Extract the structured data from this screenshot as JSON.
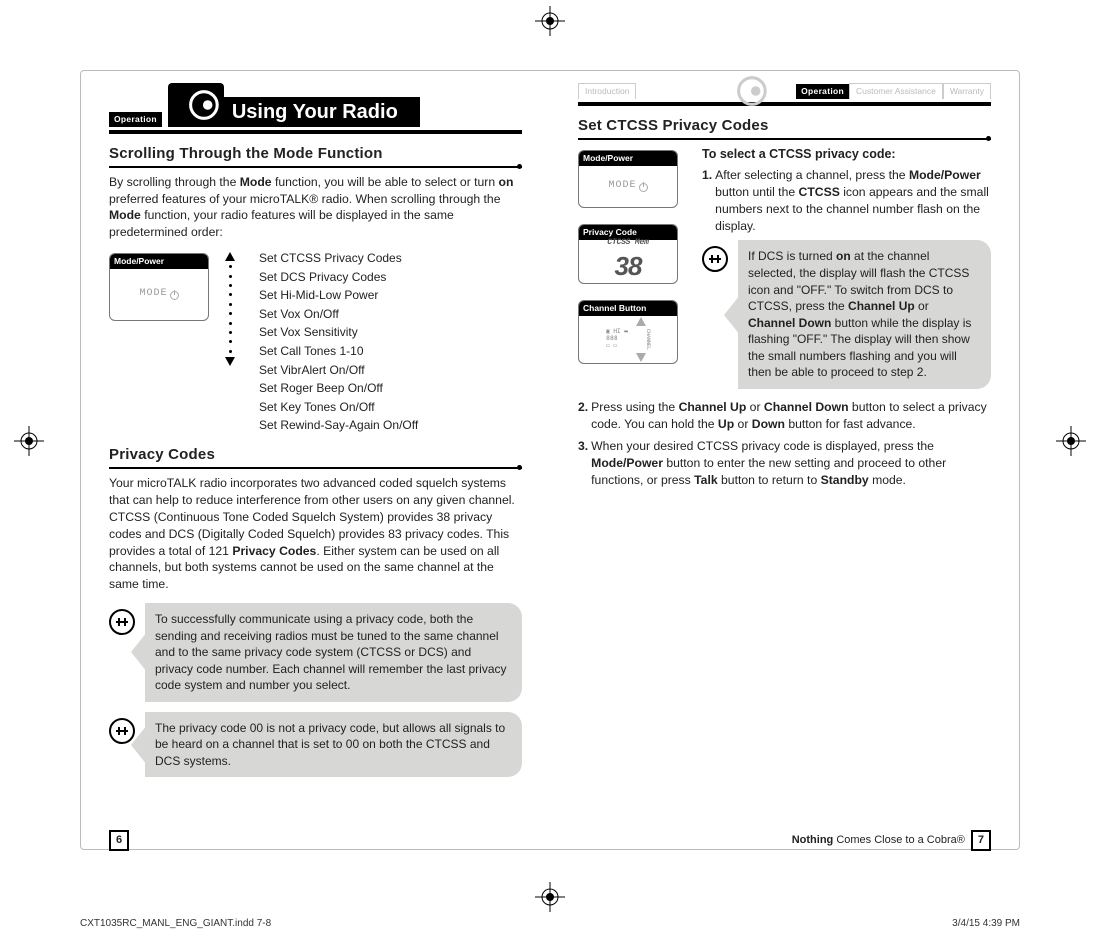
{
  "header": {
    "title": "Using Your Radio",
    "op_badge": "Operation"
  },
  "tabs": {
    "intro": "Introduction",
    "operation": "Operation",
    "cust": "Customer Assistance",
    "warranty": "Warranty"
  },
  "left": {
    "sec1_title": "Scrolling Through the Mode Function",
    "sec1_body": "By scrolling through the <b>Mode</b> function, you will be able to select or turn <b>on</b> preferred features of your microTALK® radio. When scrolling through the <b>Mode</b> function, your radio features will be displayed in the same predetermined order:",
    "icon_mode_label": "Mode/Power",
    "icon_mode_text": "MODE",
    "mode_items": [
      "Set CTCSS Privacy Codes",
      "Set DCS Privacy Codes",
      "Set Hi-Mid-Low Power",
      "Set Vox On/Off",
      "Set Vox Sensitivity",
      "Set Call Tones 1-10",
      "Set VibrAlert On/Off",
      "Set Roger Beep On/Off",
      "Set Key Tones On/Off",
      "Set Rewind-Say-Again On/Off"
    ],
    "sec2_title": "Privacy Codes",
    "sec2_body": "Your microTALK radio incorporates two advanced coded squelch systems that can help to reduce interference from other users on any given channel. CTCSS (Continuous Tone Coded Squelch System) provides 38 privacy codes and DCS (Digitally Coded Squelch) provides 83 privacy codes. This provides a total of 121 <b>Privacy Codes</b>. Either system can be used on all channels, but both systems cannot be used on the same channel at the same time.",
    "note1": "To successfully communicate using a privacy code, both the sending and receiving radios must be tuned to the same channel and to the same privacy code system (CTCSS or DCS) and privacy code number. Each channel will remember the last privacy code system and number you select.",
    "note2": "The privacy code 00 is not a privacy code, but allows all signals to be heard on a channel that is set to 00 on both the CTCSS and DCS systems."
  },
  "right": {
    "sec_title": "Set CTCSS Privacy Codes",
    "lead": "To select a CTCSS privacy code:",
    "icon1_label": "Mode/Power",
    "icon1_text": "MODE",
    "icon2_label": "Privacy Code",
    "icon2_top": "CTCSS Mem",
    "icon2_num": "38",
    "icon3_label": "Channel Button",
    "step1": "After selecting a channel, press the <b>Mode/Power</b> button until the <b>CTCSS</b> icon appears and the small numbers next to the channel number flash on the display.",
    "note": "If DCS is turned <b>on</b> at the channel selected, the display will flash the CTCSS icon and \"OFF.\" To switch from DCS to CTCSS, press the <b>Channel Up</b> or <b>Channel Down</b> button while the display is flashing \"OFF.\" The display will then show the small numbers flashing and you will then be able to proceed to step 2.",
    "step2": "Press using the <b>Channel Up</b> or <b>Channel Down</b> button to select a privacy code. You can hold the <b>Up</b> or <b>Down</b> button for fast advance.",
    "step3": "When your desired CTCSS privacy code is displayed, press the <b>Mode/Power</b> button to enter the new setting and proceed to other functions, or press <b>Talk</b> button to return to <b>Standby</b> mode."
  },
  "footer": {
    "left_page": "6",
    "right_page": "7",
    "tagline": "<b>Nothing</b> Comes Close to a Cobra®",
    "file": "CXT1035RC_MANL_ENG_GIANT.indd   7-8",
    "date": "3/4/15   4:39 PM"
  }
}
